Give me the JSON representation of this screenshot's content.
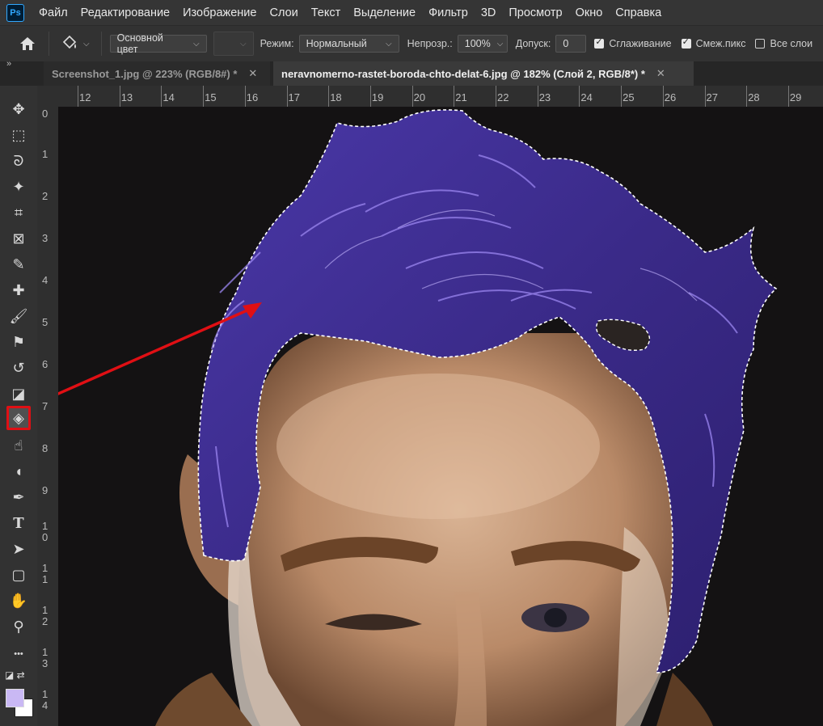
{
  "app": {
    "logo_text": "Ps",
    "menu": [
      "Файл",
      "Редактирование",
      "Изображение",
      "Слои",
      "Текст",
      "Выделение",
      "Фильтр",
      "3D",
      "Просмотр",
      "Окно",
      "Справка"
    ]
  },
  "options_bar": {
    "fill_source": "Основной цвет",
    "mode_label": "Режим:",
    "mode_value": "Нормальный",
    "opacity_label": "Непрозр.:",
    "opacity_value": "100%",
    "tolerance_label": "Допуск:",
    "tolerance_value": "0",
    "antialias_label": "Сглаживание",
    "antialias_checked": true,
    "contiguous_label": "Смеж.пикс",
    "contiguous_checked": true,
    "all_layers_label": "Все слои",
    "all_layers_checked": false
  },
  "tabs": [
    {
      "title": "Screenshot_1.jpg @ 223% (RGB/8#) *",
      "active": false
    },
    {
      "title": "neravnomerno-rastet-boroda-chto-delat-6.jpg @ 182% (Слой 2, RGB/8*) *",
      "active": true
    }
  ],
  "rulers": {
    "top_labels": [
      "12",
      "13",
      "14",
      "15",
      "16",
      "17",
      "18",
      "19",
      "20",
      "21",
      "22",
      "23",
      "24",
      "25",
      "26",
      "27",
      "28",
      "29"
    ],
    "left_labels": [
      "0",
      "1",
      "2",
      "3",
      "4",
      "5",
      "6",
      "7",
      "8",
      "9",
      "10",
      "11",
      "12",
      "13",
      "14"
    ]
  },
  "tools": [
    {
      "name": "move-tool",
      "icon": "move-icon",
      "glyph": "✥"
    },
    {
      "name": "marquee-tool",
      "icon": "marquee-icon",
      "glyph": "⬚"
    },
    {
      "name": "lasso-tool",
      "icon": "lasso-icon",
      "glyph": "ᘐ"
    },
    {
      "name": "magic-wand-tool",
      "icon": "magic-wand-icon",
      "glyph": "✦"
    },
    {
      "name": "crop-tool",
      "icon": "crop-icon",
      "glyph": "⌗"
    },
    {
      "name": "frame-tool",
      "icon": "frame-icon",
      "glyph": "⊠"
    },
    {
      "name": "eyedropper-tool",
      "icon": "eyedropper-icon",
      "glyph": "✎"
    },
    {
      "name": "healing-brush-tool",
      "icon": "healing-brush-icon",
      "glyph": "✚"
    },
    {
      "name": "brush-tool",
      "icon": "brush-icon",
      "glyph": "🖌"
    },
    {
      "name": "clone-stamp-tool",
      "icon": "stamp-icon",
      "glyph": "⚑"
    },
    {
      "name": "history-brush-tool",
      "icon": "history-brush-icon",
      "glyph": "↺"
    },
    {
      "name": "eraser-tool",
      "icon": "eraser-icon",
      "glyph": "◪"
    },
    {
      "name": "paint-bucket-tool",
      "icon": "paint-bucket-icon",
      "glyph": "◈",
      "selected": true
    },
    {
      "name": "smudge-tool",
      "icon": "smudge-icon",
      "glyph": "☝"
    },
    {
      "name": "dodge-tool",
      "icon": "dodge-icon",
      "glyph": "◖"
    },
    {
      "name": "pen-tool",
      "icon": "pen-icon",
      "glyph": "✒"
    },
    {
      "name": "type-tool",
      "icon": "type-icon",
      "glyph": "T"
    },
    {
      "name": "path-selection-tool",
      "icon": "arrow-icon",
      "glyph": "➤"
    },
    {
      "name": "shape-tool",
      "icon": "rectangle-icon",
      "glyph": "▢"
    },
    {
      "name": "hand-tool",
      "icon": "hand-icon",
      "glyph": "✋"
    },
    {
      "name": "zoom-tool",
      "icon": "zoom-icon",
      "glyph": "⚲"
    },
    {
      "name": "more-tools",
      "icon": "ellipsis-icon",
      "glyph": "•••"
    }
  ],
  "colors": {
    "foreground": "#c9b8f4",
    "background": "#ffffff",
    "hair_fill": "#3d2d8f",
    "highlight_red": "#e00f14"
  }
}
